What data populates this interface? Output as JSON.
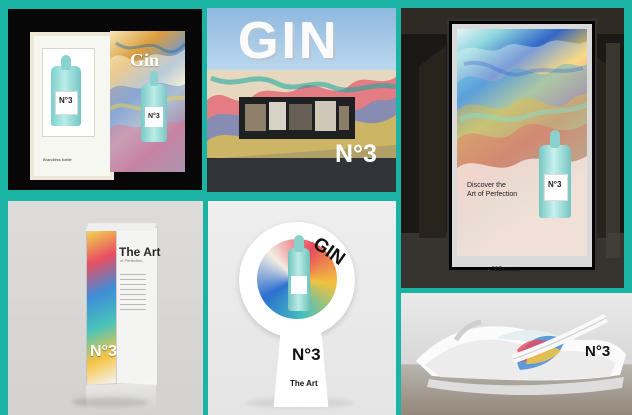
{
  "panels": {
    "posters": {
      "gin_text": "Gin",
      "small_caption": "Brandless bottle",
      "number_mark": "N°3"
    },
    "pavilion": {
      "big_sign": "GIN",
      "side_mark": "N°3"
    },
    "digital_board": {
      "headline_line1": "Discover the",
      "headline_line2": "Art of Perfection",
      "footer_brand": "JCDecaux",
      "bottle_mark": "N°3"
    },
    "box": {
      "title": "The Art",
      "subtitle": "of Perfection",
      "box_mark": "N°3"
    },
    "display": {
      "ring_text": "GIN",
      "base_text": "The Art",
      "base_mark": "N°3"
    },
    "shoe": {
      "mark": "N°3"
    }
  },
  "colors": {
    "frame": "#1bb3a3",
    "ink": "#1d1d1f",
    "teal_bottle": "#73c7c3",
    "white": "#ffffff"
  }
}
